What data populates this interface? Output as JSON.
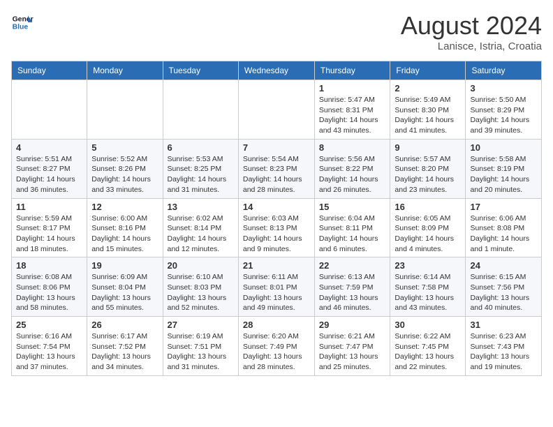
{
  "header": {
    "logo_line1": "General",
    "logo_line2": "Blue",
    "month_title": "August 2024",
    "location": "Lanisce, Istria, Croatia"
  },
  "days_of_week": [
    "Sunday",
    "Monday",
    "Tuesday",
    "Wednesday",
    "Thursday",
    "Friday",
    "Saturday"
  ],
  "weeks": [
    [
      {
        "day": "",
        "info": ""
      },
      {
        "day": "",
        "info": ""
      },
      {
        "day": "",
        "info": ""
      },
      {
        "day": "",
        "info": ""
      },
      {
        "day": "1",
        "info": "Sunrise: 5:47 AM\nSunset: 8:31 PM\nDaylight: 14 hours\nand 43 minutes."
      },
      {
        "day": "2",
        "info": "Sunrise: 5:49 AM\nSunset: 8:30 PM\nDaylight: 14 hours\nand 41 minutes."
      },
      {
        "day": "3",
        "info": "Sunrise: 5:50 AM\nSunset: 8:29 PM\nDaylight: 14 hours\nand 39 minutes."
      }
    ],
    [
      {
        "day": "4",
        "info": "Sunrise: 5:51 AM\nSunset: 8:27 PM\nDaylight: 14 hours\nand 36 minutes."
      },
      {
        "day": "5",
        "info": "Sunrise: 5:52 AM\nSunset: 8:26 PM\nDaylight: 14 hours\nand 33 minutes."
      },
      {
        "day": "6",
        "info": "Sunrise: 5:53 AM\nSunset: 8:25 PM\nDaylight: 14 hours\nand 31 minutes."
      },
      {
        "day": "7",
        "info": "Sunrise: 5:54 AM\nSunset: 8:23 PM\nDaylight: 14 hours\nand 28 minutes."
      },
      {
        "day": "8",
        "info": "Sunrise: 5:56 AM\nSunset: 8:22 PM\nDaylight: 14 hours\nand 26 minutes."
      },
      {
        "day": "9",
        "info": "Sunrise: 5:57 AM\nSunset: 8:20 PM\nDaylight: 14 hours\nand 23 minutes."
      },
      {
        "day": "10",
        "info": "Sunrise: 5:58 AM\nSunset: 8:19 PM\nDaylight: 14 hours\nand 20 minutes."
      }
    ],
    [
      {
        "day": "11",
        "info": "Sunrise: 5:59 AM\nSunset: 8:17 PM\nDaylight: 14 hours\nand 18 minutes."
      },
      {
        "day": "12",
        "info": "Sunrise: 6:00 AM\nSunset: 8:16 PM\nDaylight: 14 hours\nand 15 minutes."
      },
      {
        "day": "13",
        "info": "Sunrise: 6:02 AM\nSunset: 8:14 PM\nDaylight: 14 hours\nand 12 minutes."
      },
      {
        "day": "14",
        "info": "Sunrise: 6:03 AM\nSunset: 8:13 PM\nDaylight: 14 hours\nand 9 minutes."
      },
      {
        "day": "15",
        "info": "Sunrise: 6:04 AM\nSunset: 8:11 PM\nDaylight: 14 hours\nand 6 minutes."
      },
      {
        "day": "16",
        "info": "Sunrise: 6:05 AM\nSunset: 8:09 PM\nDaylight: 14 hours\nand 4 minutes."
      },
      {
        "day": "17",
        "info": "Sunrise: 6:06 AM\nSunset: 8:08 PM\nDaylight: 14 hours\nand 1 minute."
      }
    ],
    [
      {
        "day": "18",
        "info": "Sunrise: 6:08 AM\nSunset: 8:06 PM\nDaylight: 13 hours\nand 58 minutes."
      },
      {
        "day": "19",
        "info": "Sunrise: 6:09 AM\nSunset: 8:04 PM\nDaylight: 13 hours\nand 55 minutes."
      },
      {
        "day": "20",
        "info": "Sunrise: 6:10 AM\nSunset: 8:03 PM\nDaylight: 13 hours\nand 52 minutes."
      },
      {
        "day": "21",
        "info": "Sunrise: 6:11 AM\nSunset: 8:01 PM\nDaylight: 13 hours\nand 49 minutes."
      },
      {
        "day": "22",
        "info": "Sunrise: 6:13 AM\nSunset: 7:59 PM\nDaylight: 13 hours\nand 46 minutes."
      },
      {
        "day": "23",
        "info": "Sunrise: 6:14 AM\nSunset: 7:58 PM\nDaylight: 13 hours\nand 43 minutes."
      },
      {
        "day": "24",
        "info": "Sunrise: 6:15 AM\nSunset: 7:56 PM\nDaylight: 13 hours\nand 40 minutes."
      }
    ],
    [
      {
        "day": "25",
        "info": "Sunrise: 6:16 AM\nSunset: 7:54 PM\nDaylight: 13 hours\nand 37 minutes."
      },
      {
        "day": "26",
        "info": "Sunrise: 6:17 AM\nSunset: 7:52 PM\nDaylight: 13 hours\nand 34 minutes."
      },
      {
        "day": "27",
        "info": "Sunrise: 6:19 AM\nSunset: 7:51 PM\nDaylight: 13 hours\nand 31 minutes."
      },
      {
        "day": "28",
        "info": "Sunrise: 6:20 AM\nSunset: 7:49 PM\nDaylight: 13 hours\nand 28 minutes."
      },
      {
        "day": "29",
        "info": "Sunrise: 6:21 AM\nSunset: 7:47 PM\nDaylight: 13 hours\nand 25 minutes."
      },
      {
        "day": "30",
        "info": "Sunrise: 6:22 AM\nSunset: 7:45 PM\nDaylight: 13 hours\nand 22 minutes."
      },
      {
        "day": "31",
        "info": "Sunrise: 6:23 AM\nSunset: 7:43 PM\nDaylight: 13 hours\nand 19 minutes."
      }
    ]
  ]
}
